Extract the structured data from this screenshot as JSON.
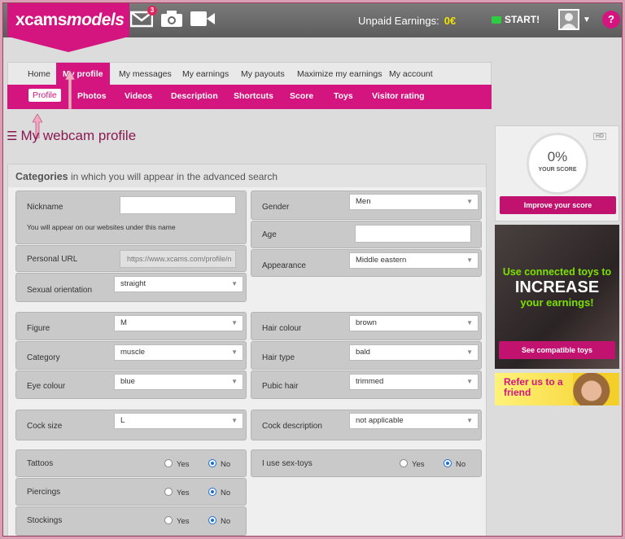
{
  "brand": {
    "logo_main": "xcams",
    "logo_em": "models",
    "accent": "#d4147f"
  },
  "header": {
    "mail_badge": "3",
    "unpaid_label": "Unpaid Earnings:",
    "unpaid_value": "0€",
    "start_label": "START!",
    "help_label": "?"
  },
  "tabs": [
    "Home",
    "My profile",
    "My messages",
    "My earnings",
    "My payouts",
    "Maximize my earnings",
    "My account"
  ],
  "subtabs": [
    "Profile",
    "Photos",
    "Videos",
    "Description",
    "Shortcuts",
    "Score",
    "Toys",
    "Visitor rating"
  ],
  "page_title": "My webcam profile",
  "panel": {
    "title_bold": "Categories",
    "title_rest": "in which you will appear in the advanced search"
  },
  "form": {
    "nickname_label": "Nickname",
    "nickname_help": "You will appear on our websites under this name",
    "nickname_value": "",
    "personal_url_label": "Personal URL",
    "personal_url_value": "https://www.xcams.com/profile/n",
    "sexual_orientation_label": "Sexual orientation",
    "sexual_orientation_value": "straight",
    "gender_label": "Gender",
    "gender_value": "Men",
    "age_label": "Age",
    "age_value": "",
    "appearance_label": "Appearance",
    "appearance_value": "Middle eastern",
    "figure_label": "Figure",
    "figure_value": "M",
    "category_label": "Category",
    "category_value": "muscle",
    "eye_colour_label": "Eye colour",
    "eye_colour_value": "blue",
    "hair_colour_label": "Hair colour",
    "hair_colour_value": "brown",
    "hair_type_label": "Hair type",
    "hair_type_value": "bald",
    "pubic_hair_label": "Pubic hair",
    "pubic_hair_value": "trimmed",
    "cock_size_label": "Cock size",
    "cock_size_value": "L",
    "cock_description_label": "Cock description",
    "cock_description_value": "not applicable",
    "tattoos_label": "Tattoos",
    "piercings_label": "Piercings",
    "stockings_label": "Stockings",
    "sex_toys_label": "I use sex-toys",
    "yes": "Yes",
    "no": "No"
  },
  "score": {
    "value": "0%",
    "label": "YOUR SCORE",
    "hd": "HD",
    "button": "Improve your score"
  },
  "promo": {
    "line1": "Use connected toys to",
    "line2": "INCREASE",
    "line3": "your earnings!",
    "button": "See compatible toys"
  },
  "refer": {
    "line1": "Refer us to a",
    "line2": "friend"
  }
}
